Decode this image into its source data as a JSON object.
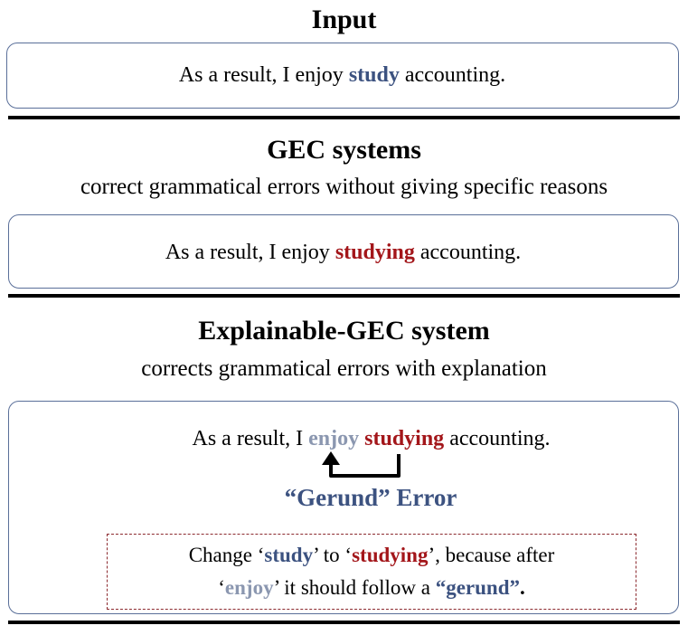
{
  "input": {
    "heading": "Input",
    "sentence": {
      "prefix": "As a result, I enjoy ",
      "highlight": "study",
      "suffix": " accounting."
    }
  },
  "gec": {
    "heading": "GEC systems",
    "description": "correct grammatical errors without giving specific reasons",
    "sentence": {
      "prefix": "As a result, I enjoy ",
      "highlight": "studying",
      "suffix": " accounting."
    }
  },
  "explainable": {
    "heading": "Explainable-GEC system",
    "description": "corrects grammatical errors with explanation",
    "sentence": {
      "prefix": "As a result, I ",
      "evidence": "enjoy",
      "space": " ",
      "highlight": "studying",
      "suffix": " accounting."
    },
    "error_type": "“Gerund” Error",
    "explanation": {
      "l1_a": "Change ‘",
      "l1_b": "study",
      "l1_c": "’ to ‘",
      "l1_d": "studying",
      "l1_e": "’, because after",
      "l2_a": "‘",
      "l2_b": "enjoy",
      "l2_c": "’ it should follow a ",
      "l2_d": "“gerund”",
      "l2_e": "."
    }
  },
  "colors": {
    "box_border": "#5a6f99",
    "original_word": "#3c5280",
    "corrected_word": "#a3161a",
    "evidence_word": "#8b97b0",
    "dashed_border": "#8c2a2f"
  }
}
